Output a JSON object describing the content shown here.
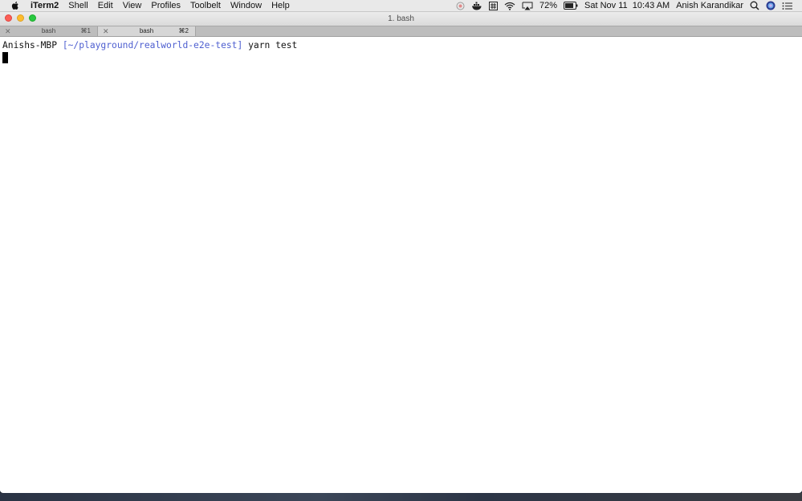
{
  "menubar": {
    "app_name": "iTerm2",
    "items": [
      "Shell",
      "Edit",
      "View",
      "Profiles",
      "Toolbelt",
      "Window",
      "Help"
    ],
    "status": {
      "battery": "72%",
      "datetime": "Sat Nov 11  10:43 AM",
      "user": "Anish Karandikar"
    },
    "icons": [
      "apple-icon",
      "record-icon",
      "docker-icon",
      "hash-icon",
      "wifi-icon",
      "airplay-icon",
      "battery-icon",
      "search-icon",
      "siri-icon",
      "notification-center-icon"
    ]
  },
  "window": {
    "title": "1. bash",
    "tabs": [
      {
        "label": "bash",
        "shortcut": "⌘1",
        "active": false
      },
      {
        "label": "bash",
        "shortcut": "⌘2",
        "active": true
      }
    ]
  },
  "terminal": {
    "host": "Anishs-MBP",
    "path": "[~/playground/realworld-e2e-test]",
    "command": "yarn test"
  },
  "colors": {
    "path_color": "#4e5fd0",
    "menubar_bg": "#e9e9e9",
    "tabbar_bg": "#bdbdbd"
  }
}
